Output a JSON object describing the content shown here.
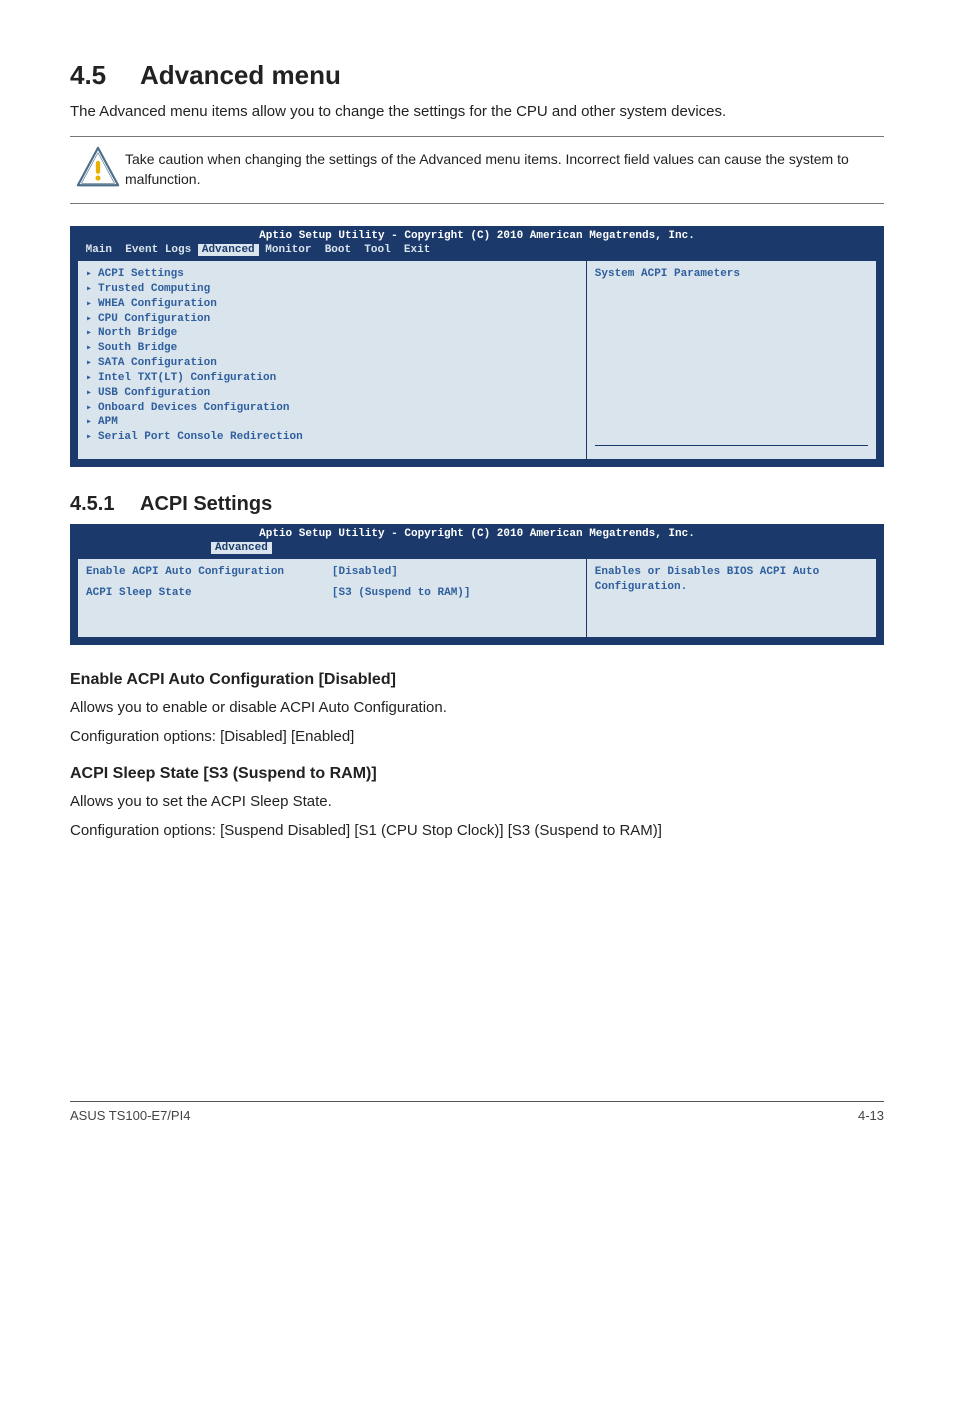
{
  "section": {
    "number": "4.5",
    "title": "Advanced menu",
    "intro": "The Advanced menu items allow you to change the settings for the CPU and other system devices.",
    "caution": "Take caution when changing the settings of the Advanced menu items. Incorrect field values can cause the system to malfunction."
  },
  "bios1": {
    "header": "Aptio Setup Utility - Copyright (C) 2010 American Megatrends, Inc.",
    "tabs": {
      "main": "Main",
      "eventlogs": "Event Logs",
      "advanced": "Advanced",
      "monitor": "Monitor",
      "boot": "Boot",
      "tool": "Tool",
      "exit": "Exit"
    },
    "items": [
      "ACPI Settings",
      "Trusted Computing",
      "WHEA Configuration",
      "CPU Configuration",
      "North Bridge",
      "South Bridge",
      "SATA Configuration",
      "Intel TXT(LT) Configuration",
      "USB Configuration",
      "Onboard Devices Configuration",
      "APM",
      "Serial Port Console Redirection"
    ],
    "help": "System ACPI Parameters"
  },
  "subsection": {
    "number": "4.5.1",
    "title": "ACPI Settings"
  },
  "bios2": {
    "header": "Aptio Setup Utility - Copyright (C) 2010 American Megatrends, Inc.",
    "tab": "Advanced",
    "row1_label": "Enable ACPI Auto Configuration",
    "row1_value": "[Disabled]",
    "row2_label": "ACPI Sleep State",
    "row2_value": "[S3 (Suspend to RAM)]",
    "help": "Enables or Disables BIOS ACPI Auto Configuration."
  },
  "opt1": {
    "heading": "Enable ACPI Auto Configuration [Disabled]",
    "line1": "Allows you to enable or disable ACPI Auto Configuration.",
    "line2": "Configuration options: [Disabled] [Enabled]"
  },
  "opt2": {
    "heading": "ACPI Sleep State [S3 (Suspend to RAM)]",
    "line1": "Allows you to set the ACPI Sleep State.",
    "line2": "Configuration options: [Suspend Disabled] [S1 (CPU Stop Clock)] [S3 (Suspend to RAM)]"
  },
  "footer": {
    "left": "ASUS TS100-E7/PI4",
    "right": "4-13"
  }
}
